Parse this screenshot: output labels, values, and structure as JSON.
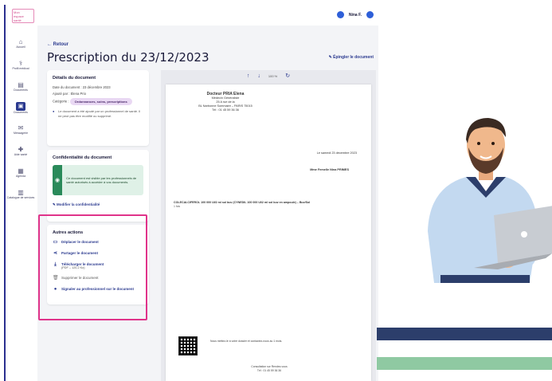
{
  "app": {
    "logo_lines": [
      "Mon",
      "espace",
      "santé"
    ],
    "user_name": "Nina F."
  },
  "sidebar": {
    "items": [
      {
        "icon": "home-icon",
        "label": "Accueil"
      },
      {
        "icon": "profile-icon",
        "label": "Profil médical"
      },
      {
        "icon": "cabinet-icon",
        "label": "Documents"
      },
      {
        "icon": "documents-icon",
        "label": "Documents",
        "active": true
      },
      {
        "icon": "mail-icon",
        "label": "Messagerie"
      },
      {
        "icon": "help-icon",
        "label": "Aide santé"
      },
      {
        "icon": "agenda-icon",
        "label": "Agenda"
      },
      {
        "icon": "catalog-icon",
        "label": "Catalogue de services"
      }
    ]
  },
  "header": {
    "back_label": "Retour",
    "title": "Prescription du 23/12/2023",
    "print_label": "Épingler le document"
  },
  "details": {
    "title": "Détails du document",
    "date_line": "Date du document : 23 décembre 2023",
    "added_line": "Ajouté par : Elena Prio",
    "category_label": "Catégorie :",
    "category_value": "Ordonnances, soins, prescriptions",
    "note": "Le document a été ajouté par un professionnel de santé. Il ne peut pas être modifié ou supprimé."
  },
  "confidentiality": {
    "title": "Confidentialité du document",
    "text": "Ce document est visible par les professionnels de santé autorisés à accéder à vos documents.",
    "link": "Modifier la confidentialité"
  },
  "actions": {
    "title": "Autres actions",
    "items": [
      {
        "icon": "move-icon",
        "label": "Déplacer le document",
        "sub": ""
      },
      {
        "icon": "share-icon",
        "label": "Partager le document",
        "sub": ""
      },
      {
        "icon": "download-icon",
        "label": "Télécharger le document",
        "sub": "(PDF – 120,2 Ko)"
      },
      {
        "icon": "trash-icon",
        "label": "Supprimer le document",
        "sub": ""
      },
      {
        "icon": "info-icon",
        "label": "Signaler au professionnel sur le document",
        "sub": ""
      }
    ]
  },
  "viewer": {
    "zoom": "100 %",
    "doctor_name": "Docteur PRIA Elena",
    "doctor_spec": "Médecin Généraliste",
    "doctor_addr": "25 A rue de la",
    "doctor_city": "BL Narbonne Sommaire – PARIS 75015",
    "doctor_tel": "Tél : 01 45 59 36 36",
    "date_line": "Le samedi 23 décembre 2023",
    "patient_line": "Mme Femelle Nina PRIMES",
    "rx_line": "COLECALCIFEROL 100 000 UI/2 ml sol buv (CYNEDIL 100 000 UI/2 ml sol buv en ampoule) – Buv/Sol",
    "rx_sub": "1 fois",
    "footer_line": "Nous mettez-le à votre dossier et contactez-nous au 1 mois.",
    "footer_sign1": "Consultation sur Rendez-vous",
    "footer_sign2": "Tél : 01 45 59 36 36"
  },
  "colors": {
    "brand": "#2b3a8f",
    "highlight": "#e0338a",
    "stripe_dark": "#2c3e6b",
    "stripe_green": "#8fc9a2"
  }
}
